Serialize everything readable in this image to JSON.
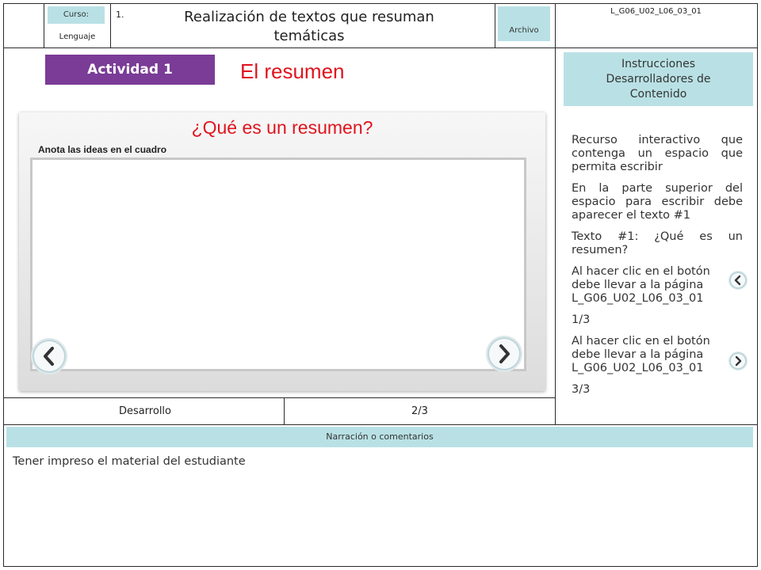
{
  "header": {
    "course_label": "Curso:",
    "subject": "Lenguaje",
    "item_number": "1.",
    "title": "Realización de textos que resuman temáticas",
    "file_label": "Archivo",
    "code": "L_G06_U02_L06_03_01"
  },
  "activity": {
    "badge": "Actividad 1",
    "title": "El resumen"
  },
  "card": {
    "question": "¿Qué es un resumen?",
    "instruction": "Anota las ideas en el cuadro",
    "textarea_value": ""
  },
  "right_panel": {
    "header": "Instrucciones Desarrolladores de Contenido",
    "p1": "Recurso interactivo que contenga un espacio que permita escribir",
    "p2": "En la parte superior del espacio para escribir debe aparecer el texto #1",
    "p3": "Texto #1: ¿Qué es un resumen?",
    "p4_line1": "Al hacer clic en el botón",
    "p4_line2": "debe llevar a la página",
    "p4_code": "L_G06_U02_L06_03_01",
    "p4_page": "1/3",
    "p5_line1": "Al hacer clic en el botón",
    "p5_line2": "debe llevar a la página",
    "p5_code": "L_G06_U02_L06_03_01",
    "p5_page": "3/3"
  },
  "footer_row": {
    "stage": "Desarrollo",
    "page": "2/3"
  },
  "narration": {
    "header": "Narración o comentarios",
    "text": "Tener impreso el material del estudiante"
  },
  "colors": {
    "activity_purple": "#7a3c96",
    "title_red": "#e0141e",
    "info_cyan": "#b9e1e5"
  },
  "icons": {
    "prev": "chevron-left-icon",
    "next": "chevron-right-icon"
  }
}
